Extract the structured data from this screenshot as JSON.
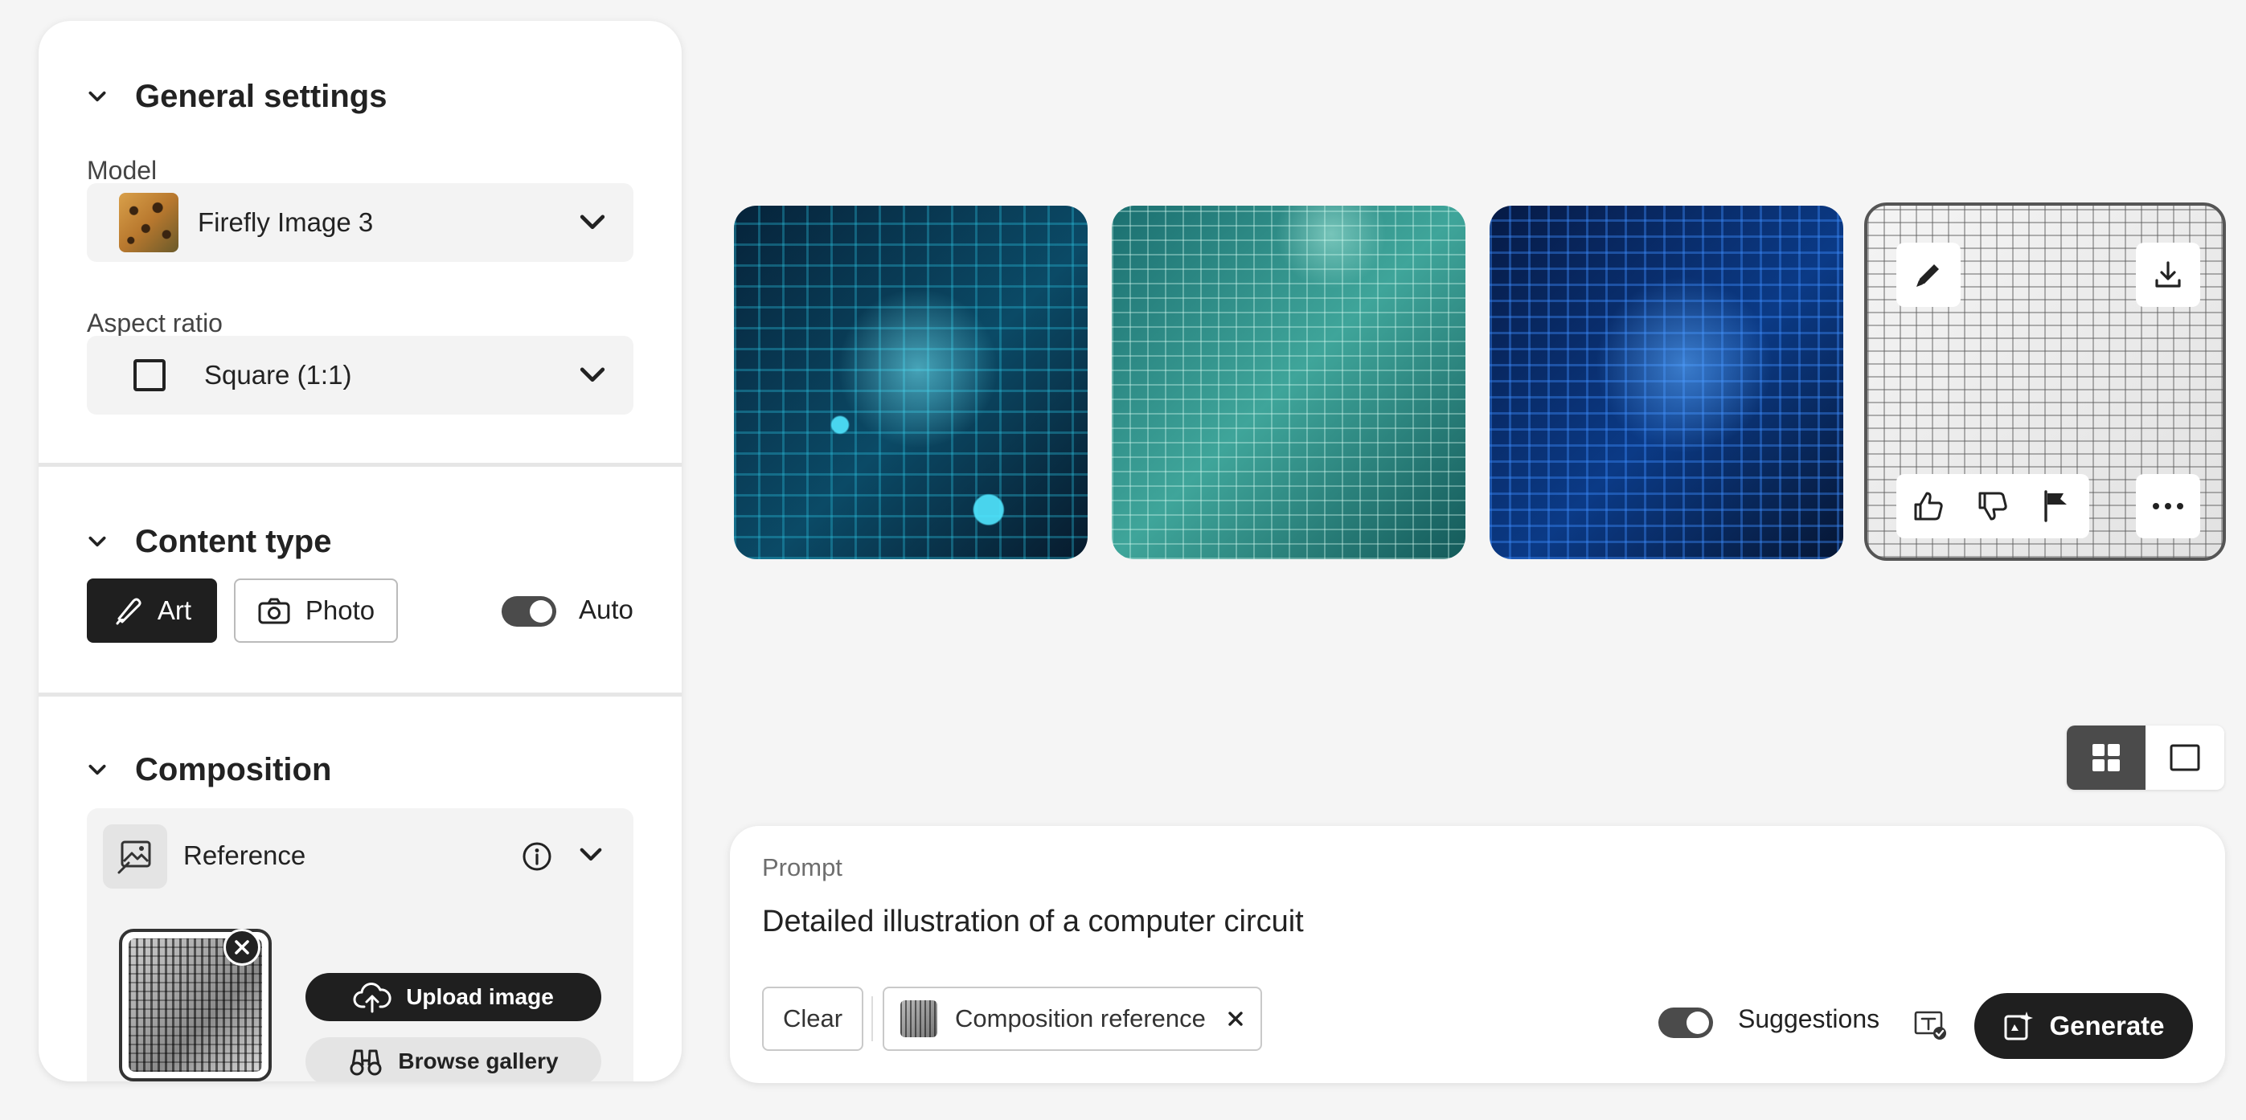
{
  "settings": {
    "general": {
      "title": "General settings",
      "model_label": "Model",
      "model_value": "Firefly Image 3",
      "aspect_label": "Aspect ratio",
      "aspect_value": "Square (1:1)"
    },
    "content_type": {
      "title": "Content type",
      "art_label": "Art",
      "photo_label": "Photo",
      "auto_label": "Auto",
      "selected": "Art"
    },
    "composition": {
      "title": "Composition",
      "reference_label": "Reference",
      "upload_label": "Upload image",
      "browse_label": "Browse gallery"
    }
  },
  "results": {
    "count": 4,
    "selected_index": 3
  },
  "view_toggle": {
    "selected": "grid"
  },
  "prompt": {
    "label": "Prompt",
    "text": "Detailed illustration of a computer circuit",
    "clear_label": "Clear",
    "chip_label": "Composition reference",
    "suggestions_label": "Suggestions",
    "generate_label": "Generate"
  },
  "colors": {
    "dark": "#1f1f1f",
    "toggle_on": "#4b4b4b",
    "panel_bg": "#ffffff",
    "page_bg": "#f5f5f5"
  }
}
